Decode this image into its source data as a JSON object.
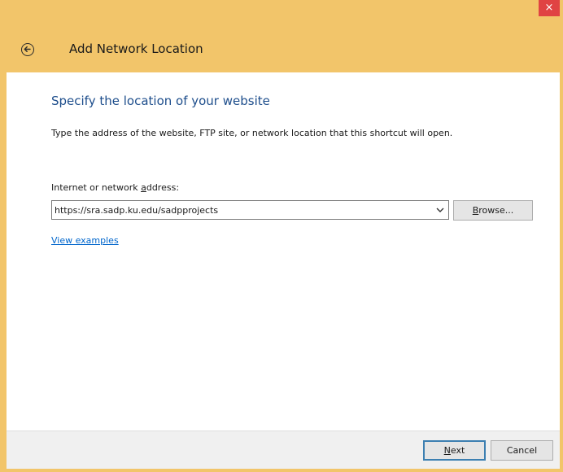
{
  "window": {
    "title": "Add Network Location",
    "close_glyph": "×"
  },
  "colors": {
    "frame": "#f2c56a",
    "close_button": "#e04343",
    "heading": "#1e4e8c",
    "link": "#0066cc"
  },
  "page": {
    "heading": "Specify the location of your website",
    "instruction": "Type the address of the website, FTP site, or network location that this shortcut will open."
  },
  "address": {
    "label_prefix": "Internet or network ",
    "label_accel": "a",
    "label_suffix": "ddress:",
    "value": "https://sra.sadp.ku.edu/sadpprojects"
  },
  "buttons": {
    "browse_accel": "B",
    "browse_rest": "rowse...",
    "next_accel": "N",
    "next_rest": "ext",
    "cancel": "Cancel"
  },
  "links": {
    "view_examples": "View examples"
  },
  "icons": {
    "back": "back-arrow-icon",
    "close": "close-icon",
    "dropdown": "chevron-down-icon"
  }
}
